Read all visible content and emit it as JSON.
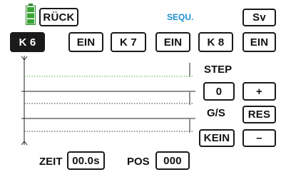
{
  "header": {
    "back_label": "RÜCK",
    "title": "SEQU.",
    "save_label": "Sv"
  },
  "channels": [
    {
      "name": "K 6",
      "state": "EIN"
    },
    {
      "name": "K 7",
      "state": "EIN"
    },
    {
      "name": "K 8",
      "state": "EIN"
    }
  ],
  "right_panel": {
    "step_label": "STEP",
    "step_value": "0",
    "plus_label": "+",
    "gs_label": "G/S",
    "res_label": "RES",
    "gs_value": "KEIN",
    "minus_label": "–"
  },
  "footer": {
    "zeit_label": "ZEIT",
    "zeit_value": "00.0s",
    "pos_label": "POS",
    "pos_value": "000"
  },
  "colors": {
    "battery": "#3aa335",
    "title": "#1f8fcf",
    "graph_line_highlight": "#4caf50"
  },
  "icons": {
    "battery": "battery-icon"
  }
}
